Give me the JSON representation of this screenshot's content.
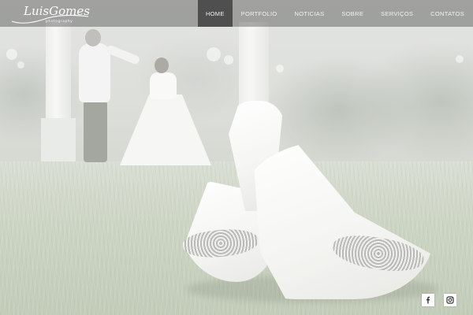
{
  "brand": {
    "logo_script": "LuisGomes",
    "logo_sub": "photography"
  },
  "nav": {
    "items": [
      {
        "label": "HOME",
        "active": true
      },
      {
        "label": "PORTFOLIO",
        "active": false
      },
      {
        "label": "NOTICIAS",
        "active": false
      },
      {
        "label": "SOBRE",
        "active": false
      },
      {
        "label": "SERVIÇOS",
        "active": false
      },
      {
        "label": "CONTATOS",
        "active": false
      }
    ]
  },
  "social": {
    "links": [
      {
        "icon": "facebook-icon"
      },
      {
        "icon": "instagram-icon"
      }
    ]
  },
  "colors": {
    "nav_bg": "#464646",
    "nav_active": "#4f4f4f",
    "nav_text": "#f2f2f2"
  }
}
